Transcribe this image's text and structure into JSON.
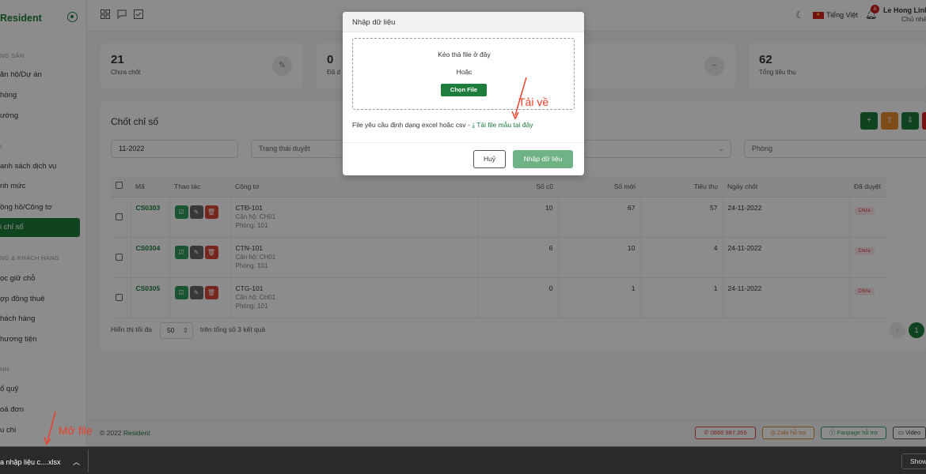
{
  "app": {
    "brand": "Resident"
  },
  "sidebar": {
    "sections": [
      "NG SẢN",
      "I",
      "NG & KHÁCH HÀNG",
      "NH"
    ],
    "items": [
      {
        "label": "ăn hộ/Dự án"
      },
      {
        "label": "hòng"
      },
      {
        "label": "ường"
      },
      {
        "label": "anh sách dịch vụ"
      },
      {
        "label": "nh mức"
      },
      {
        "label": "ồng hồ/Công tơ"
      },
      {
        "label": "i chỉ số",
        "active": true
      },
      {
        "label": "ọc giữ chỗ"
      },
      {
        "label": "ợp đồng thuê"
      },
      {
        "label": "hách hàng"
      },
      {
        "label": "hương tiện"
      },
      {
        "label": "ổ quỹ"
      },
      {
        "label": "oá đơn"
      },
      {
        "label": "u chi"
      }
    ]
  },
  "topbar": {
    "language": "Tiếng Việt",
    "notification_count": "6",
    "user_name": "Le Hong Linh",
    "user_role": "Chủ nhà"
  },
  "stats": [
    {
      "value": "21",
      "label": "Chưa chốt"
    },
    {
      "value": "0",
      "label": "Đã d"
    },
    {
      "value": "62",
      "label": "Tổng tiêu thụ"
    }
  ],
  "panel": {
    "title": "Chốt chỉ số",
    "filters": {
      "month": "11-2022",
      "status": "Trạng thái duyệt",
      "room": "Phòng"
    }
  },
  "table": {
    "headers": [
      "Mã",
      "Thao tác",
      "Công tơ",
      "Số cũ",
      "Số mới",
      "Tiêu thụ",
      "Ngày chốt",
      "Đã duyệt"
    ],
    "rows": [
      {
        "code": "CS0303",
        "meter": "CTĐ-101",
        "apartment": "Căn hộ: CH01",
        "room": "Phòng: 101",
        "old": "10",
        "new": "67",
        "usage": "57",
        "date": "24-11-2022",
        "status": "Chưa"
      },
      {
        "code": "CS0304",
        "meter": "CTN-101",
        "apartment": "Căn hộ: CH01",
        "room": "Phòng: 101",
        "old": "6",
        "new": "10",
        "usage": "4",
        "date": "24-11-2022",
        "status": "Chưa"
      },
      {
        "code": "CS0305",
        "meter": "CTG-101",
        "apartment": "Căn hộ: CH01",
        "room": "Phòng: 101",
        "old": "0",
        "new": "1",
        "usage": "1",
        "date": "24-11-2022",
        "status": "Chưa"
      }
    ]
  },
  "pager": {
    "show_label": "Hiển thị tối đa",
    "page_size": "50",
    "total_label": "trên tổng số 3 kết quả",
    "current_page": "1",
    "prev": "‹"
  },
  "footer": {
    "copyright": "© 2022",
    "brand": "Resident",
    "phone": "0868.987.355",
    "zalo": "Zalo hỗ trợ",
    "fanpage": "Fanpage hỗ trợ",
    "video": "Video"
  },
  "modal": {
    "title": "Nhập dữ liệu",
    "drag_text": "Kéo thả file ở đây",
    "or_text": "Hoặc",
    "choose_button": "Chọn File",
    "requirement": "File yêu cầu định dạng excel hoặc csv -",
    "template_link": "Tải file mẫu tại đây",
    "cancel": "Huỷ",
    "import": "Nhập dữ liệu"
  },
  "annotations": {
    "download": "Tải về",
    "open_file": "Mở file"
  },
  "download_bar": {
    "filename": "a nhập liệu c....xlsx",
    "show_all": "Show"
  },
  "colors": {
    "brand": "#1e7d3c",
    "annotation": "#e8402a",
    "danger": "#d32020"
  }
}
